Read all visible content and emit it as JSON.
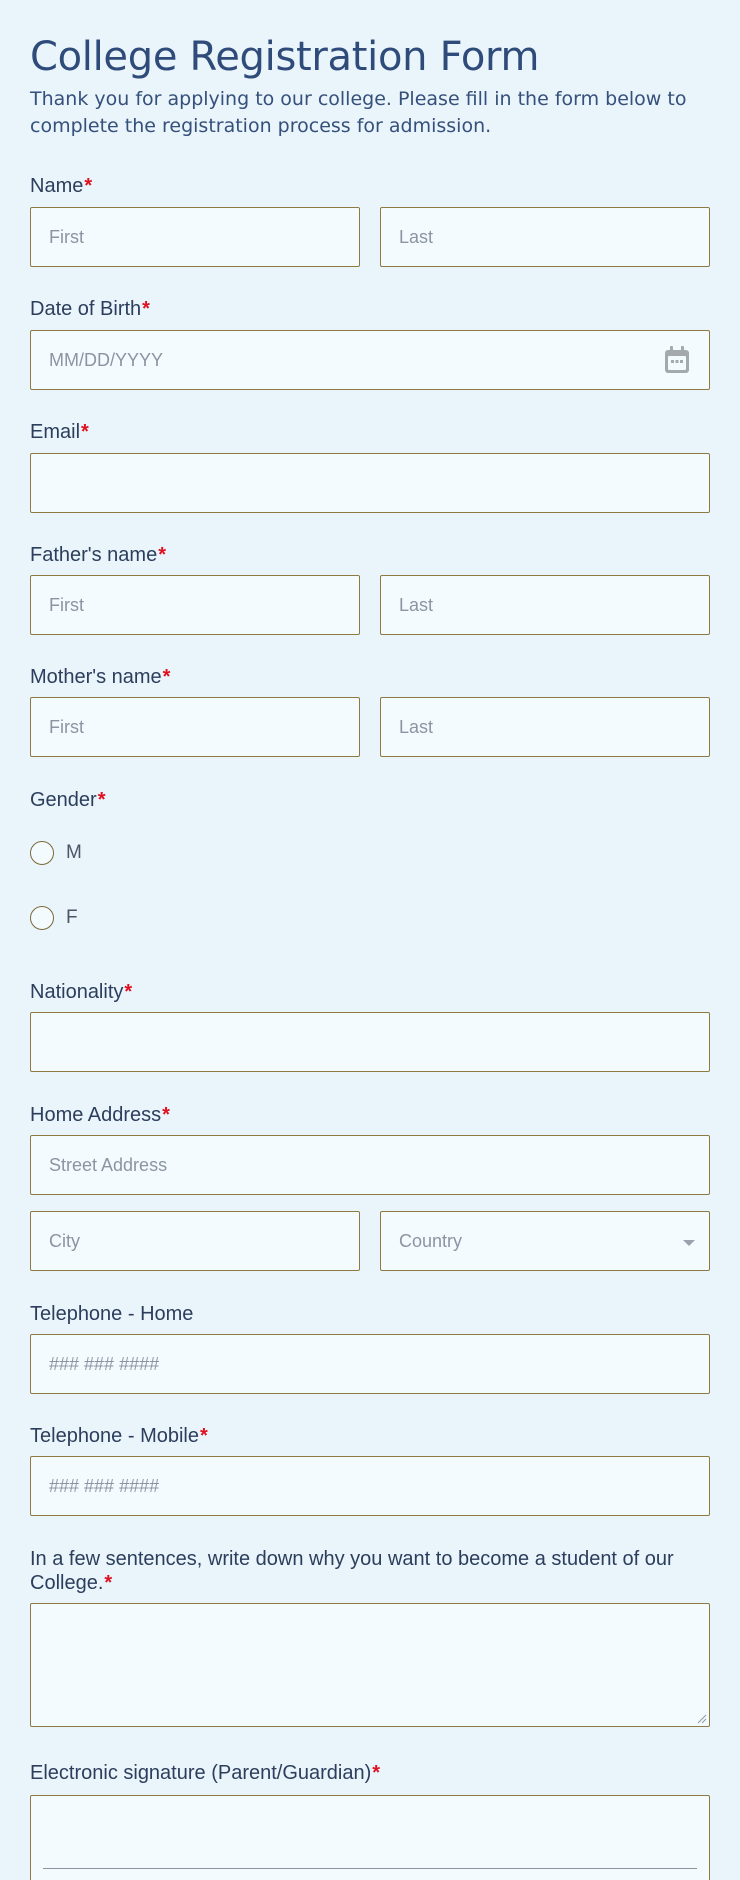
{
  "form": {
    "title": "College Registration Form",
    "subtitle": "Thank you for applying to our college. Please fill in the form below to complete the registration process for admission.",
    "required_mark": "*"
  },
  "fields": {
    "name": {
      "label": "Name",
      "first_placeholder": "First",
      "last_placeholder": "Last",
      "required": true
    },
    "dob": {
      "label": "Date of Birth",
      "placeholder": "MM/DD/YYYY",
      "icon": "calendar-icon",
      "required": true
    },
    "email": {
      "label": "Email",
      "placeholder": "",
      "required": true
    },
    "father": {
      "label": "Father's name",
      "first_placeholder": "First",
      "last_placeholder": "Last",
      "required": true
    },
    "mother": {
      "label": "Mother's name",
      "first_placeholder": "First",
      "last_placeholder": "Last",
      "required": true
    },
    "gender": {
      "label": "Gender",
      "options": [
        "M",
        "F"
      ],
      "required": true
    },
    "nationality": {
      "label": "Nationality",
      "placeholder": "",
      "required": true
    },
    "address": {
      "label": "Home Address",
      "street_placeholder": "Street Address",
      "city_placeholder": "City",
      "country_placeholder": "Country",
      "required": true
    },
    "phone_home": {
      "label": "Telephone - Home",
      "placeholder": "### ### ####",
      "required": false
    },
    "phone_mobile": {
      "label": "Telephone - Mobile",
      "placeholder": "### ### ####",
      "required": true
    },
    "essay": {
      "label": "In a few sentences, write down why you want to become a student of our College.",
      "required": true
    },
    "signature": {
      "label": "Electronic signature (Parent/Guardian)",
      "required": true
    }
  },
  "colors": {
    "background": "#e9f4fb",
    "field_background": "#f4fbfe",
    "field_border": "#8c7a40",
    "title": "#2e4b7a",
    "required": "#e0101f"
  }
}
